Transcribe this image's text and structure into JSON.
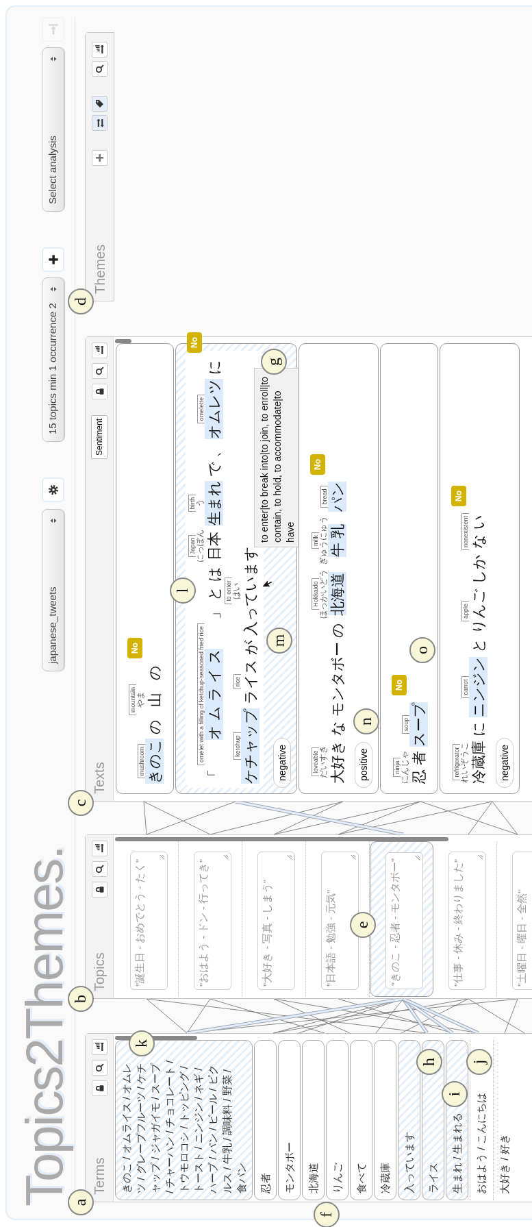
{
  "title": "Topics2Themes.",
  "toolbar": {
    "dataset": "japanese_tweets",
    "topic_model": "15 topics min 1 occurrence 2",
    "analysis": "Select analysis"
  },
  "terms": {
    "label": "Terms",
    "items": [
      {
        "text": "きのこ / オムライス / オムレツ / グレープフルーツ / ケチャップ / ジャガイモ / スープ / チャーハン / チョコレート / トウモロコシ / トッピング / トースト / ニンジン / ネギ / ハーブ / パン / ビール / ピクルス / 牛乳 / 調味料 / 野菜 / 食パン",
        "highlighted": true,
        "linked": true
      },
      {
        "text": "忍者",
        "highlighted": false,
        "linked": true
      },
      {
        "text": "モンタボー",
        "highlighted": false,
        "linked": true
      },
      {
        "text": "北海道",
        "highlighted": false,
        "linked": true
      },
      {
        "text": "りんご",
        "highlighted": false,
        "linked": true
      },
      {
        "text": "食べて",
        "highlighted": false,
        "linked": true
      },
      {
        "text": "冷蔵庫",
        "highlighted": false,
        "linked": true
      },
      {
        "text": "入っています",
        "highlighted": true,
        "linked": true
      },
      {
        "text": "ライス",
        "highlighted": true,
        "linked": true
      },
      {
        "text": "生まれ / 生まれる",
        "highlighted": true,
        "linked": true
      },
      {
        "text": "おはよう / こんにちは",
        "highlighted": false,
        "linked": false
      },
      {
        "text": "大好き / 好き",
        "highlighted": false,
        "linked": false
      }
    ]
  },
  "topics": {
    "label": "Topics",
    "items": [
      {
        "text": "\"誕生日 - おめでとう - たく\"",
        "selected": false
      },
      {
        "text": "\"おはよう - ドン - 行ってき\"",
        "selected": false
      },
      {
        "text": "\"大好き - 写真 - しまう\"",
        "selected": false
      },
      {
        "text": "\"日本語 - 勉強 - 元気\"",
        "selected": false
      },
      {
        "text": "\"きのこ - 忍者 - モンタボー\"",
        "selected": true
      },
      {
        "text": "\"仕事 - 休み - 終わりました\"",
        "selected": false
      },
      {
        "text": "\"土曜日 - 曜日 - 全然\"",
        "selected": false
      }
    ]
  },
  "texts": {
    "label": "Texts",
    "sort_button": "Sentiment",
    "items": [
      {
        "selected": false,
        "label": "No",
        "lines": [
          [
            {
              "word": "きのこ",
              "gloss": "mushroom",
              "highlight": true
            },
            {
              "word": "の",
              "highlight": false
            },
            {
              "word": "山",
              "gloss": "mountain",
              "reading": "やま",
              "highlight": false
            },
            {
              "word": "の",
              "highlight": false
            }
          ]
        ]
      },
      {
        "selected": true,
        "label": "No",
        "sentiment": "negative",
        "tooltip": "to enter|to break into|to join, to enroll|to contain, to hold, to accommodate|to have",
        "lines": [
          [
            {
              "word": "「",
              "highlight": false
            },
            {
              "word": "オ ム ラ イ ス",
              "gloss": "omelet with a filling of ketchup-seasoned fried rice",
              "highlight": true
            },
            {
              "word": "」",
              "highlight": false
            },
            {
              "word": "と",
              "highlight": false
            },
            {
              "word": "は",
              "highlight": false
            },
            {
              "word": "日本",
              "gloss": "Japan",
              "reading": "にっぽん",
              "highlight": false
            },
            {
              "word": "生まれ",
              "gloss": "birth",
              "reading": "う",
              "highlight": true
            },
            {
              "word": "で",
              "highlight": false
            },
            {
              "word": "、",
              "highlight": false
            },
            {
              "word": "オムレツ",
              "gloss": "omelette",
              "highlight": true
            },
            {
              "word": "に",
              "highlight": false
            }
          ],
          [
            {
              "word": "ケチャップ",
              "gloss": "ketchup",
              "highlight": true
            },
            {
              "word": "ライス",
              "gloss": "rice",
              "highlight": false
            },
            {
              "word": "が",
              "highlight": false
            },
            {
              "word": "入っています",
              "gloss": "to enter",
              "reading": "はい",
              "highlight": false
            }
          ]
        ]
      },
      {
        "selected": false,
        "label": "No",
        "sentiment": "positive",
        "lines": [
          [
            {
              "word": "大好き",
              "gloss": "loveable",
              "reading": "だいすき",
              "highlight": false
            },
            {
              "word": "な",
              "highlight": false
            },
            {
              "word": "モンタボー",
              "highlight": false
            },
            {
              "word": "の",
              "highlight": false
            },
            {
              "word": "北海道",
              "gloss": "Hokkaido",
              "reading": "ほっかいどう",
              "highlight": true
            },
            {
              "word": "牛 乳",
              "gloss": "milk",
              "reading": "ぎゅうにゅう",
              "highlight": true
            },
            {
              "word": "パン",
              "gloss": "bread",
              "highlight": true
            }
          ]
        ]
      },
      {
        "selected": false,
        "label": "No",
        "lines": [
          [
            {
              "word": "忍 者",
              "gloss": "ninja",
              "reading": "にんじゃ",
              "highlight": false
            },
            {
              "word": "スープ",
              "gloss": "soup",
              "highlight": true
            }
          ]
        ]
      },
      {
        "selected": false,
        "label": "No",
        "sentiment": "negative",
        "lines": [
          [
            {
              "word": "冷蔵庫",
              "gloss": "refrigerator",
              "reading": "れいぞうこ",
              "highlight": false
            },
            {
              "word": "に",
              "highlight": false
            },
            {
              "word": "ニンジン",
              "gloss": "carrot",
              "highlight": true
            },
            {
              "word": "と",
              "highlight": false
            },
            {
              "word": "りんご",
              "gloss": "apple",
              "highlight": false
            },
            {
              "word": "しか",
              "highlight": false
            },
            {
              "word": "な い",
              "gloss": "nonexistent",
              "highlight": false
            }
          ]
        ]
      }
    ]
  },
  "themes": {
    "label": "Themes",
    "tools": [
      {
        "kind": "add",
        "active": false
      },
      {
        "kind": "swap",
        "active": true
      },
      {
        "kind": "tag",
        "active": true
      },
      {
        "kind": "search",
        "active": false
      },
      {
        "kind": "sort",
        "active": false
      }
    ]
  },
  "callouts": [
    {
      "letter": "a"
    },
    {
      "letter": "b"
    },
    {
      "letter": "c"
    },
    {
      "letter": "d"
    },
    {
      "letter": "e"
    },
    {
      "letter": "f"
    },
    {
      "letter": "g"
    },
    {
      "letter": "h"
    },
    {
      "letter": "i"
    },
    {
      "letter": "j"
    },
    {
      "letter": "k"
    },
    {
      "letter": "l"
    },
    {
      "letter": "m"
    },
    {
      "letter": "n"
    },
    {
      "letter": "o"
    }
  ]
}
